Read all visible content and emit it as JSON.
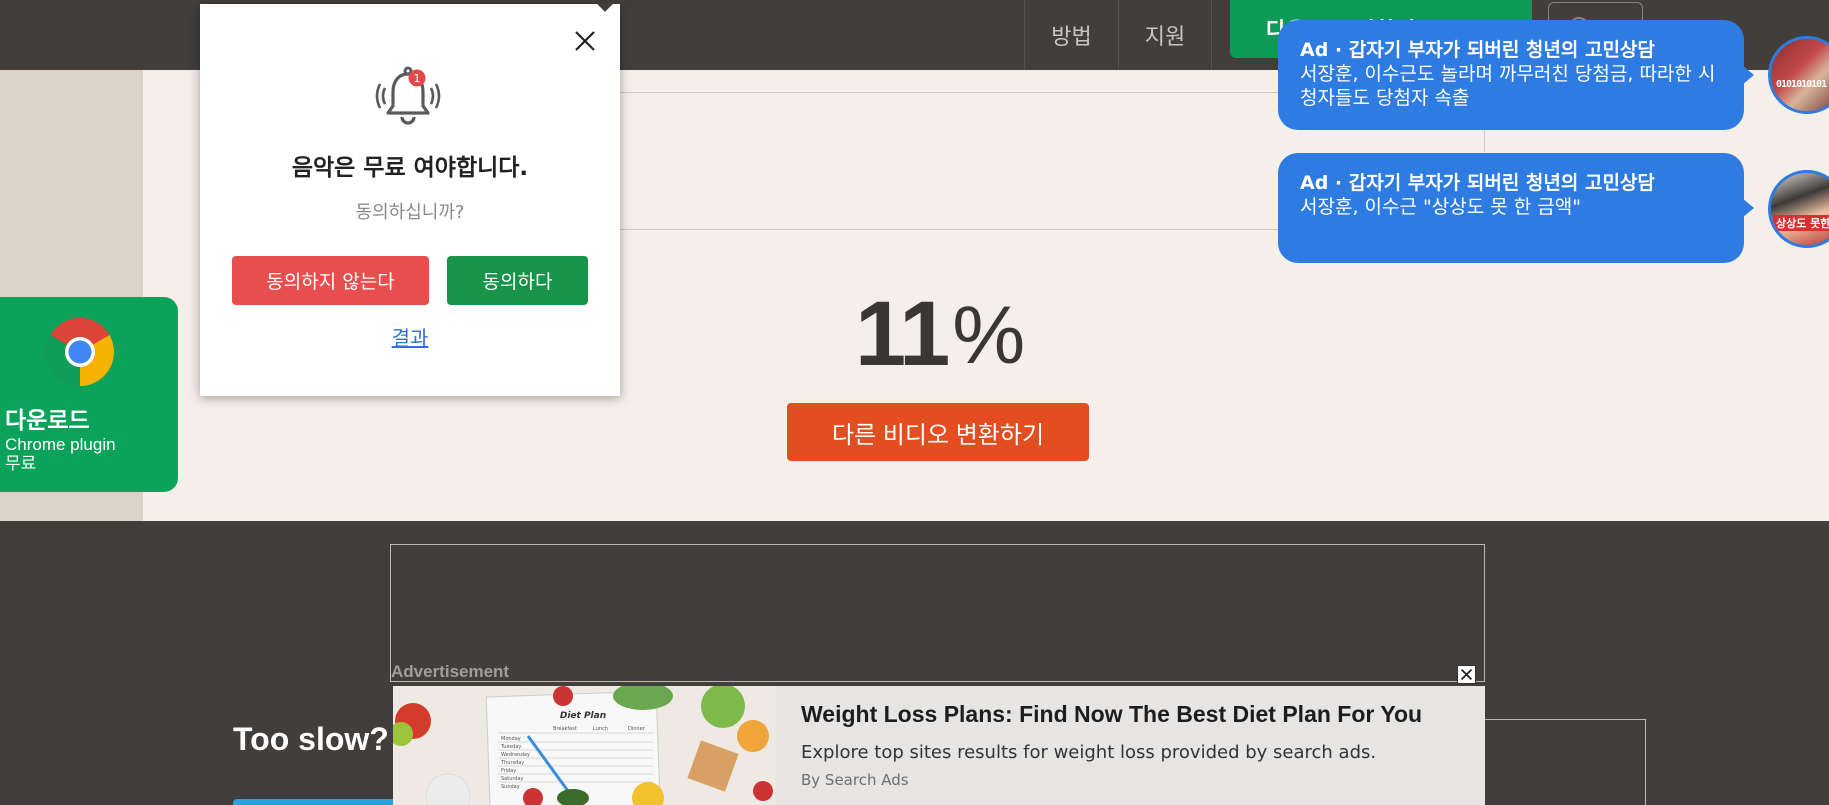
{
  "header": {
    "nav_how": "방법",
    "nav_support": "지원",
    "download_button": "다운로드 변환기 무료"
  },
  "main": {
    "progress_percent": 11,
    "percent_number": "11",
    "percent_sign": "%",
    "convert_other_label": "다른 비디오 변환하기"
  },
  "chrome_plugin": {
    "title": "다운로드",
    "line1": "Chrome plugin",
    "line2": "무료"
  },
  "notification": {
    "badge": "1",
    "title": "음악은 무료 여야합니다.",
    "question": "동의하십니까?",
    "deny_label": "동의하지 않는다",
    "agree_label": "동의하다",
    "result_link": "결과"
  },
  "chat_ads": [
    {
      "title": "Ad · 갑자기 부자가 되버린 청년의 고민상담",
      "body": "서장훈, 이수근도 놀라며 까무러친 당첨금, 따라한 시청자들도 당첨자 속출"
    },
    {
      "title": "Ad · 갑자기 부자가 되버린 청년의 고민상담",
      "body": "서장훈, 이수근 \"상상도 못 한 금액\""
    }
  ],
  "avatar_captions": [
    "0101010101",
    "상상도 못한"
  ],
  "advertisement": {
    "label": "Advertisement",
    "headline": "Weight Loss Plans: Find Now The Best Diet Plan For You",
    "description": "Explore top sites results for weight loss provided by search ads.",
    "source": "By Search Ads",
    "image_heading": "Diet Plan",
    "image_columns": [
      "Breakfast",
      "Lunch",
      "Dinner"
    ],
    "image_days": [
      "Monday",
      "Tuesday",
      "Wednesday",
      "Thursday",
      "Friday",
      "Saturday",
      "Sunday"
    ]
  },
  "footer": {
    "too_slow": "Too slow? C"
  },
  "colors": {
    "header_bg": "#423e3c",
    "accent_green": "#0f9a55",
    "convert_orange": "#e24e1f",
    "chat_blue": "#2e7ce2",
    "deny_red": "#e94e4e"
  }
}
